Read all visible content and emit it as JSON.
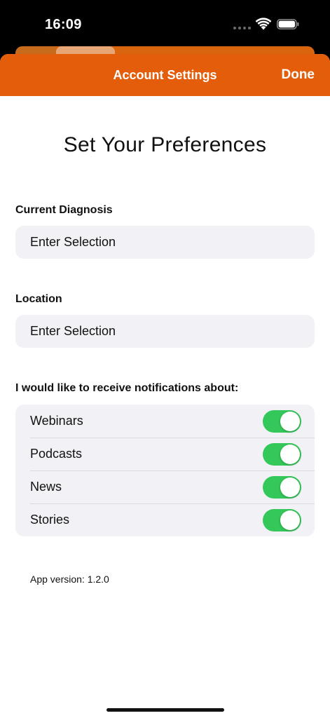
{
  "status_bar": {
    "time": "16:09",
    "wifi_icon": "wifi-icon",
    "battery_icon": "battery-icon"
  },
  "nav": {
    "title": "Account Settings",
    "done_label": "Done"
  },
  "page": {
    "title": "Set Your Preferences"
  },
  "diagnosis": {
    "label": "Current Diagnosis",
    "value": "Enter Selection"
  },
  "location": {
    "label": "Location",
    "value": "Enter Selection"
  },
  "notifications": {
    "label": "I would like to receive notifications about:",
    "items": [
      {
        "label": "Webinars",
        "on": true
      },
      {
        "label": "Podcasts",
        "on": true
      },
      {
        "label": "News",
        "on": true
      },
      {
        "label": "Stories",
        "on": true
      }
    ]
  },
  "footer": {
    "app_version": "App version: 1.2.0"
  },
  "colors": {
    "accent": "#e35d0a",
    "toggle_on": "#34c759",
    "field_bg": "#f2f2f6"
  }
}
